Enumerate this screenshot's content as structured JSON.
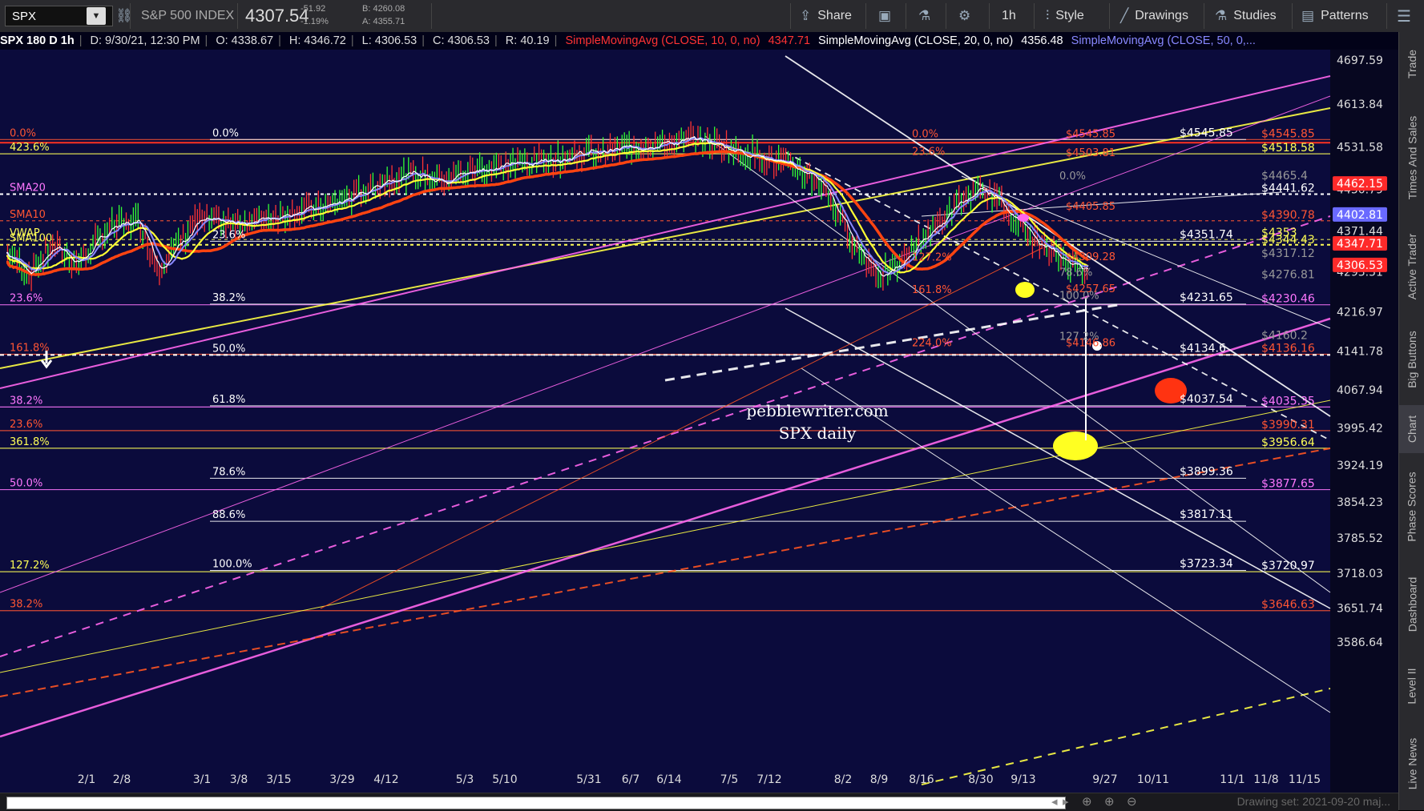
{
  "toolbar": {
    "symbol": "SPX",
    "index_name": "S&P 500 INDEX",
    "last_price": "4307.54",
    "change": "-51.92",
    "change_pct": "-1.19%",
    "bid": "B: 4260.08",
    "ask": "A: 4355.71",
    "share": "Share",
    "timeframe": "1h",
    "style": "Style",
    "drawings": "Drawings",
    "studies": "Studies",
    "patterns": "Patterns"
  },
  "infobar": {
    "title": "SPX 180 D 1h",
    "date": "D: 9/30/21, 12:30 PM",
    "open": "O: 4338.67",
    "high": "H: 4346.72",
    "low": "L: 4306.53",
    "close": "C: 4306.53",
    "range": "R: 40.19",
    "sma10_label": "SimpleMovingAvg (CLOSE, 10, 0, no)",
    "sma10_value": "4347.71",
    "sma20_label": "SimpleMovingAvg (CLOSE, 20, 0, no)",
    "sma20_value": "4356.48",
    "sma50_label": "SimpleMovingAvg (CLOSE, 50, 0,..."
  },
  "colors": {
    "background": "#0b0b3c",
    "sma10": "#ff2222",
    "sma20": "#ffffff",
    "sma50": "#8888ff",
    "fib_orange": "#ff5522",
    "fib_yellow": "#ffff44",
    "magenta": "#ff66ee"
  },
  "watermark": [
    "pebblewriter.com",
    "SPX daily"
  ],
  "chart_data": {
    "type": "line",
    "title": "",
    "x_ticks": [
      "2/1",
      "2/8",
      "3/1",
      "3/8",
      "3/15",
      "3/29",
      "4/12",
      "5/3",
      "5/10",
      "5/31",
      "6/7",
      "6/14",
      "7/5",
      "7/12",
      "8/2",
      "8/9",
      "8/16",
      "8/30",
      "9/13",
      "9/27",
      "10/11",
      "11/1",
      "11/8",
      "11/15"
    ],
    "y_ticks": [
      4697.59,
      4613.84,
      4531.58,
      4450.79,
      4371.44,
      4293.51,
      4216.97,
      4141.78,
      4067.94,
      3995.42,
      3924.19,
      3854.23,
      3785.52,
      3718.03,
      3651.74,
      3586.64
    ],
    "ylim": [
      3560,
      4735
    ],
    "axis_badges": [
      {
        "value": "4462.15",
        "color": "#ff2a2a"
      },
      {
        "value": "4402.81",
        "color": "#6a6aff"
      },
      {
        "value": "4347.71",
        "color": "#ff2a2a"
      },
      {
        "value": "4306.53",
        "color": "#ff2a2a"
      }
    ],
    "left_labels": [
      {
        "text": "0.0%",
        "price": 4545.85,
        "color": "#ff5533"
      },
      {
        "text": "423.6%",
        "price": 4518.58,
        "color": "#ffff55"
      },
      {
        "text": "SMA20",
        "price": 4441.62,
        "color": "#ff77ff"
      },
      {
        "text": "SMA10",
        "price": 4390.78,
        "color": "#ff5533"
      },
      {
        "text": "VWAP",
        "price": 4355,
        "color": "#ffff55"
      },
      {
        "text": "SMA100",
        "price": 4345,
        "color": "#ffff55"
      },
      {
        "text": "23.6%",
        "price": 4230.46,
        "color": "#ff77ff"
      },
      {
        "text": "161.8%",
        "price": 4136,
        "color": "#ff5533"
      },
      {
        "text": "38.2%",
        "price": 4035.35,
        "color": "#ff77ff"
      },
      {
        "text": "23.6%",
        "price": 3990.31,
        "color": "#ff5533"
      },
      {
        "text": "361.8%",
        "price": 3956.64,
        "color": "#ffff55"
      },
      {
        "text": "50.0%",
        "price": 3877.65,
        "color": "#ff77ff"
      },
      {
        "text": "127.2%",
        "price": 3720.97,
        "color": "#ffff55"
      },
      {
        "text": "38.2%",
        "price": 3646.63,
        "color": "#ff5533"
      }
    ],
    "mid_labels": [
      {
        "text": "0.0%",
        "price": 4545.85
      },
      {
        "text": "23.6%",
        "price": 4351.74
      },
      {
        "text": "38.2%",
        "price": 4231.65
      },
      {
        "text": "50.0%",
        "price": 4134.6
      },
      {
        "text": "61.8%",
        "price": 4037.54
      },
      {
        "text": "78.6%",
        "price": 3899.36
      },
      {
        "text": "88.6%",
        "price": 3817.11
      },
      {
        "text": "100.0%",
        "price": 3723.34
      }
    ],
    "right_labels_white": [
      {
        "text": "$4545.85",
        "price": 4545.85
      },
      {
        "text": "$4351.74",
        "price": 4351.74
      },
      {
        "text": "$4231.65",
        "price": 4231.65
      },
      {
        "text": "$4134.6",
        "price": 4134.6
      },
      {
        "text": "$4037.54",
        "price": 4037.54
      },
      {
        "text": "$3899.36",
        "price": 3899.36
      },
      {
        "text": "$3817.11",
        "price": 3817.11
      },
      {
        "text": "$3723.34",
        "price": 3723.34
      }
    ],
    "right_labels_color": [
      {
        "text": "$4545.85",
        "price": 4545.85,
        "color": "#ff5533"
      },
      {
        "text": "$4518.58",
        "price": 4518.58,
        "color": "#ffff55"
      },
      {
        "text": "$4465.4",
        "price": 4465.4,
        "color": "#999999"
      },
      {
        "text": "$4441.62",
        "price": 4441.62,
        "color": "#ffffff"
      },
      {
        "text": "$4390.78",
        "price": 4390.78,
        "color": "#ff5533"
      },
      {
        "text": "$4353",
        "price": 4357,
        "color": "#ffff55"
      },
      {
        "text": "$4344.43",
        "price": 4343,
        "color": "#ffff55"
      },
      {
        "text": "$4317.12",
        "price": 4317.12,
        "color": "#999999"
      },
      {
        "text": "$4276.81",
        "price": 4276.81,
        "color": "#999999"
      },
      {
        "text": "$4230.46",
        "price": 4230.46,
        "color": "#ff77ff"
      },
      {
        "text": "$4160.2",
        "price": 4160.2,
        "color": "#999999"
      },
      {
        "text": "$4136.16",
        "price": 4136.16,
        "color": "#ff5533"
      },
      {
        "text": "$4035.35",
        "price": 4035.35,
        "color": "#ff77ff"
      },
      {
        "text": "$3990.31",
        "price": 3990.31,
        "color": "#ff5533"
      },
      {
        "text": "$3956.64",
        "price": 3956.64,
        "color": "#ffff55"
      },
      {
        "text": "$3877.65",
        "price": 3877.65,
        "color": "#ff77ff"
      },
      {
        "text": "$3720.97",
        "price": 3720.97,
        "color": "#ffffff"
      },
      {
        "text": "$3646.63",
        "price": 3646.63,
        "color": "#ff5533"
      }
    ],
    "small_fib_labels": [
      {
        "text": "0.0%",
        "price": 4545.85,
        "color": "#ff5533"
      },
      {
        "text": "$4545.85",
        "price": 4545.85,
        "color": "#ff5533"
      },
      {
        "text": "23.6%",
        "price": 4512,
        "color": "#ff5533"
      },
      {
        "text": "$4503.81",
        "price": 4510,
        "color": "#ff5533"
      },
      {
        "text": "0.0%",
        "price": 4465.4,
        "color": "#999999"
      },
      {
        "text": "$4405.85",
        "price": 4407,
        "color": "#ff5533"
      },
      {
        "text": "127.2%",
        "price": 4310,
        "color": "#ff5533"
      },
      {
        "text": "$4309.28",
        "price": 4311,
        "color": "#ff5533"
      },
      {
        "text": "78.6%",
        "price": 4281,
        "color": "#999999"
      },
      {
        "text": "161.8%",
        "price": 4248,
        "color": "#ff5533"
      },
      {
        "text": "$4257.65",
        "price": 4250,
        "color": "#ff5533"
      },
      {
        "text": "100.0%",
        "price": 4237,
        "color": "#999999"
      },
      {
        "text": "127.2%",
        "price": 4159,
        "color": "#999999"
      },
      {
        "text": "224.0%",
        "price": 4146.86,
        "color": "#ff5533"
      },
      {
        "text": "$4146.86",
        "price": 4146.86,
        "color": "#ff5533"
      }
    ],
    "price_anchors": [
      [
        0,
        4330
      ],
      [
        5,
        4290
      ],
      [
        10,
        4345
      ],
      [
        15,
        4310
      ],
      [
        22,
        4380
      ],
      [
        28,
        4390
      ],
      [
        32,
        4300
      ],
      [
        40,
        4390
      ],
      [
        48,
        4385
      ],
      [
        54,
        4395
      ],
      [
        62,
        4410
      ],
      [
        68,
        4420
      ],
      [
        74,
        4440
      ],
      [
        80,
        4470
      ],
      [
        86,
        4480
      ],
      [
        92,
        4470
      ],
      [
        100,
        4490
      ],
      [
        108,
        4500
      ],
      [
        116,
        4510
      ],
      [
        122,
        4520
      ],
      [
        128,
        4525
      ],
      [
        134,
        4535
      ],
      [
        140,
        4540
      ],
      [
        146,
        4545
      ],
      [
        150,
        4535
      ],
      [
        156,
        4520
      ],
      [
        162,
        4505
      ],
      [
        168,
        4485
      ],
      [
        172,
        4460
      ],
      [
        176,
        4390
      ],
      [
        180,
        4330
      ],
      [
        184,
        4290
      ],
      [
        188,
        4300
      ],
      [
        192,
        4350
      ],
      [
        196,
        4380
      ],
      [
        200,
        4420
      ],
      [
        204,
        4445
      ],
      [
        208,
        4440
      ],
      [
        212,
        4400
      ],
      [
        216,
        4360
      ],
      [
        220,
        4330
      ],
      [
        224,
        4310
      ],
      [
        228,
        4300
      ]
    ]
  },
  "bottombar": {
    "drawing_set": "Drawing set: 2021-09-20 maj..."
  },
  "right_tabs": [
    "Trade",
    "Times And Sales",
    "Active Trader",
    "Big Buttons",
    "Chart",
    "Phase Scores",
    "Dashboard",
    "Level II",
    "Live News"
  ]
}
